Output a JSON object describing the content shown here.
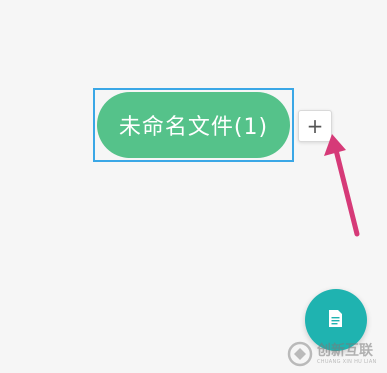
{
  "canvas": {
    "background": "#f6f6f6"
  },
  "node": {
    "label": "未命名文件(1)",
    "fill_color": "#55c28a",
    "selection_color": "#3aa7e6"
  },
  "add_button": {
    "label": "+"
  },
  "annotation": {
    "arrow_color": "#d63a78",
    "points_to": "add-child-button"
  },
  "fab": {
    "color": "#1fb3b0",
    "icon": "document-icon"
  },
  "watermark": {
    "title": "创新互联",
    "subtitle": "CHUANG XIN HU LIAN",
    "icon": "logo-icon"
  }
}
